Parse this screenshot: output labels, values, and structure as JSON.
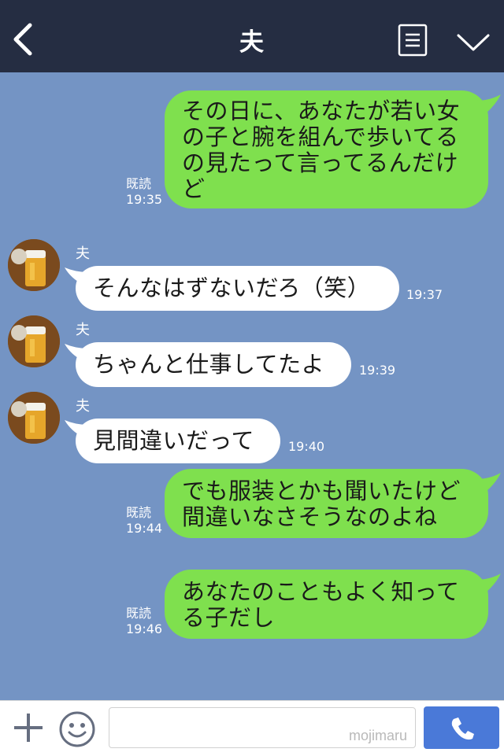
{
  "header": {
    "title": "夫"
  },
  "messages": {
    "m1": {
      "text_lines": [
        "その日に、あなたが若い女",
        "の子と腕を組んで歩いてる",
        "の見たって言ってるんだけ",
        "ど"
      ],
      "read": "既読",
      "time": "19:35"
    },
    "m2": {
      "sender": "夫",
      "text": "そんなはずないだろ（笑）",
      "time": "19:37"
    },
    "m3": {
      "sender": "夫",
      "text": "ちゃんと仕事してたよ",
      "time": "19:39"
    },
    "m4": {
      "sender": "夫",
      "text": "見間違いだって",
      "time": "19:40"
    },
    "m5": {
      "text_lines": [
        "でも服装とかも聞いたけど",
        "間違いなさそうなのよね"
      ],
      "read": "既読",
      "time": "19:44"
    },
    "m6": {
      "text_lines": [
        "あなたのこともよく知って",
        "る子だし"
      ],
      "read": "既読",
      "time": "19:46"
    }
  },
  "footer": {
    "watermark": "mojimaru"
  },
  "icons": {
    "back": "chevron-left-icon",
    "menu": "list-icon",
    "down": "chevron-down-icon",
    "plus": "plus-icon",
    "emoji": "smiley-icon",
    "call": "phone-icon"
  },
  "colors": {
    "background": "#7494c4",
    "header": "#252d42",
    "my_bubble": "#7fe04e",
    "their_bubble": "#ffffff",
    "call_button": "#4a79d8"
  }
}
